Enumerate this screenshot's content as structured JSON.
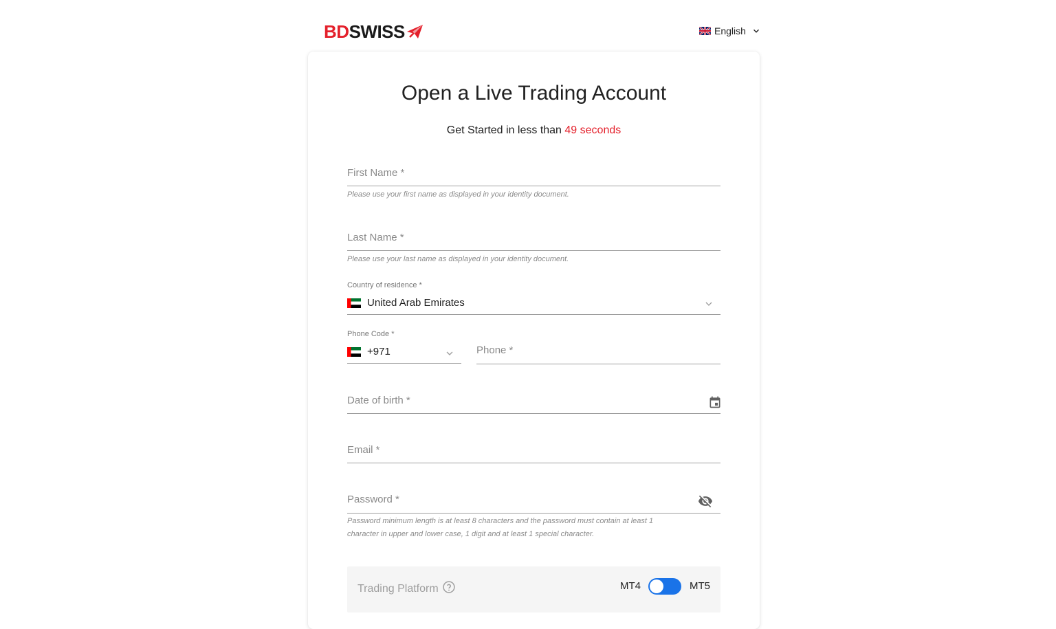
{
  "brand": {
    "name_part1": "BD",
    "name_part2": "SWISS",
    "primary_color": "#e4202b"
  },
  "language": {
    "selected": "English",
    "flag_icon": "uk-flag-icon"
  },
  "header": {
    "title": "Open a Live Trading Account",
    "subtitle_prefix": "Get Started in less than",
    "subtitle_accent": "49 seconds"
  },
  "form": {
    "first_name": {
      "label": "First Name *",
      "helper": "Please use your first name as displayed in your identity document."
    },
    "last_name": {
      "label": "Last Name *",
      "helper": "Please use your last name as displayed in your identity document."
    },
    "country": {
      "label": "Country of residence *",
      "value": "United Arab Emirates"
    },
    "phone_code": {
      "label": "Phone Code *",
      "value": "+971"
    },
    "phone": {
      "label": "Phone *"
    },
    "date_of_birth": {
      "label": "Date of birth *"
    },
    "email": {
      "label": "Email *"
    },
    "password": {
      "label": "Password *",
      "helper_line1": "Password minimum length is at least 8 characters and the password must contain at least 1",
      "helper_line2": "character in upper and lower case, 1 digit and at least 1 special character."
    },
    "trading_platform": {
      "label": "Trading Platform",
      "option_left": "MT4",
      "option_right": "MT5",
      "selected": "MT5",
      "toggle_color": "#1a73e8"
    }
  }
}
